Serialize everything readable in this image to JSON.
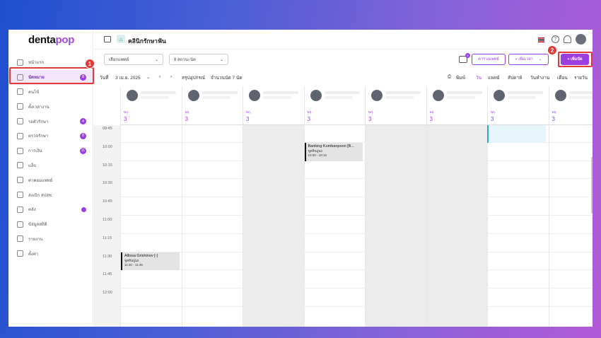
{
  "brand": {
    "part1": "denta",
    "part2": "pop"
  },
  "sidebar": {
    "items": [
      {
        "label": "หน้าแรก",
        "icon": "home-icon",
        "badge": ""
      },
      {
        "label": "นัดหมาย",
        "icon": "calendar-icon",
        "badge": "0",
        "active": true
      },
      {
        "label": "คนไข้",
        "icon": "user-icon",
        "badge": ""
      },
      {
        "label": "ตั้งเวลางาน",
        "icon": "clipboard-icon",
        "badge": ""
      },
      {
        "label": "รอตัวรักษา",
        "icon": "waiting-icon",
        "badge": "4"
      },
      {
        "label": "ตรวจรักษา",
        "icon": "treatment-icon",
        "badge": "8"
      },
      {
        "label": "การเงิน",
        "icon": "money-icon",
        "badge": "11"
      },
      {
        "label": "แล็บ",
        "icon": "tooth-icon",
        "badge": ""
      },
      {
        "label": "ค่าคอมแพทย์",
        "icon": "percent-icon",
        "badge": ""
      },
      {
        "label": "ส่งเบิก สปสช.",
        "icon": "cloud-icon",
        "badge": ""
      },
      {
        "label": "คลัง",
        "icon": "box-icon",
        "badge": "",
        "dot": true
      },
      {
        "label": "ข้อมูลสถิติ",
        "icon": "info-icon",
        "badge": ""
      },
      {
        "label": "รายงาน",
        "icon": "chart-icon",
        "badge": ""
      },
      {
        "label": "ตั้งค่า",
        "icon": "gear-icon",
        "badge": ""
      }
    ]
  },
  "header": {
    "clinic": "คลินิกรักษาฟัน"
  },
  "toolbar": {
    "doctor_select": "เลือกแพทย์",
    "status_select": "8 สถานะนัด",
    "inbox_badge": "6",
    "schedule_btn": "ตารางแพทย์",
    "addtime_btn": "+ เพิ่มเวลา",
    "add_btn": "+ เพิ่มนัด"
  },
  "datebar": {
    "day_label": "วันที่",
    "date": "3 เม.ย. 2025",
    "summary": "สรุปอุปกรณ์",
    "count": "จำนวนนัด 7 นัด",
    "print": "พิมพ์",
    "views": [
      "วัน",
      "แพทย์",
      "สัปดาห์",
      "วันทำงาน",
      "เดือน",
      "รายวัน"
    ]
  },
  "columns": [
    {
      "weekday": "พฤ.",
      "day": "3"
    },
    {
      "weekday": "พฤ.",
      "day": "3"
    },
    {
      "weekday": "พฤ.",
      "day": "3"
    },
    {
      "weekday": "พฤ.",
      "day": "3"
    },
    {
      "weekday": "พฤ.",
      "day": "3"
    },
    {
      "weekday": "พฤ.",
      "day": "3"
    },
    {
      "weekday": "พฤ.",
      "day": "3"
    },
    {
      "weekday": "พฤ.",
      "day": "3"
    }
  ],
  "times": [
    "09:45",
    "10:00",
    "10:15",
    "10:30",
    "10:45",
    "11:00",
    "11:15",
    "11:30",
    "11:45",
    "12:00"
  ],
  "appointments": [
    {
      "name": "Banking Kumbanpoon [B...",
      "sub": "ขูดหินปูน2",
      "time": "10:00 - 10:15"
    },
    {
      "name": "Allissa Grishinov [-]",
      "sub": "ขูดหินปูน2",
      "time": "11:30 - 11:45"
    }
  ],
  "steps": [
    "1",
    "2"
  ]
}
